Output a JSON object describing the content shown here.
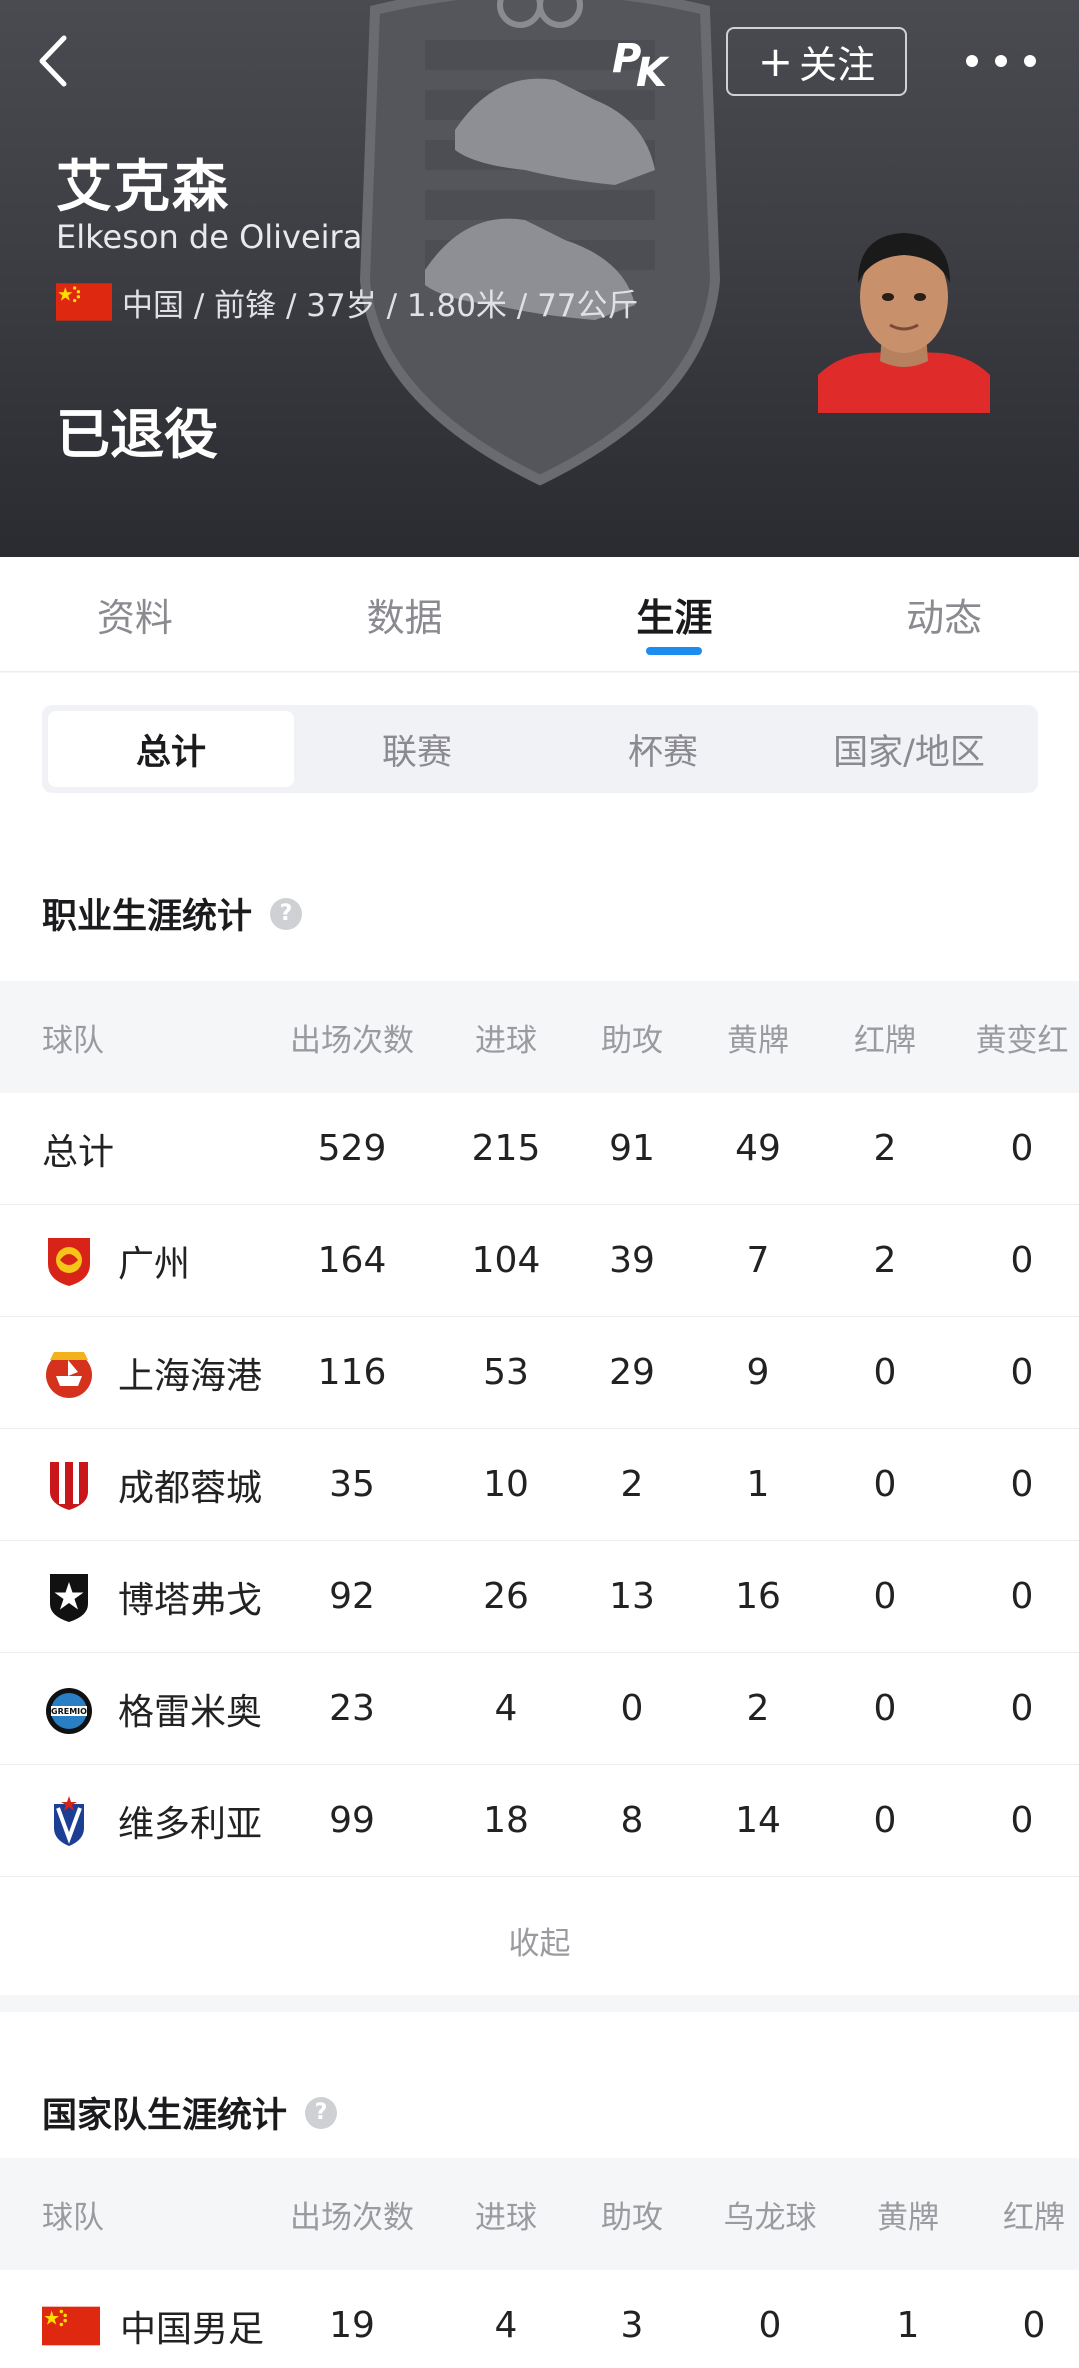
{
  "header": {
    "follow_label": "关注",
    "player_name": "艾克森",
    "player_name_en": "Elkeson de Oliveira",
    "info": "中国 / 前锋 / 37岁 / 1.80米 / 77公斤",
    "status": "已退役"
  },
  "tabs": [
    "资料",
    "数据",
    "生涯",
    "动态"
  ],
  "active_tab": "生涯",
  "segments": [
    "总计",
    "联赛",
    "杯赛",
    "国家/地区"
  ],
  "active_segment": "总计",
  "career": {
    "title": "职业生涯统计",
    "headers": [
      "球队",
      "出场次数",
      "进球",
      "助攻",
      "黄牌",
      "红牌",
      "黄变红"
    ],
    "rows": [
      {
        "team": "总计",
        "logo": "",
        "values": [
          "529",
          "215",
          "91",
          "49",
          "2",
          "0"
        ]
      },
      {
        "team": "广州",
        "logo": "guangzhou-logo",
        "values": [
          "164",
          "104",
          "39",
          "7",
          "2",
          "0"
        ]
      },
      {
        "team": "上海海港",
        "logo": "shanghai-port-logo",
        "values": [
          "116",
          "53",
          "29",
          "9",
          "0",
          "0"
        ]
      },
      {
        "team": "成都蓉城",
        "logo": "chengdu-logo",
        "values": [
          "35",
          "10",
          "2",
          "1",
          "0",
          "0"
        ]
      },
      {
        "team": "博塔弗戈",
        "logo": "botafogo-logo",
        "values": [
          "92",
          "26",
          "13",
          "16",
          "0",
          "0"
        ]
      },
      {
        "team": "格雷米奥",
        "logo": "gremio-logo",
        "values": [
          "23",
          "4",
          "0",
          "2",
          "0",
          "0"
        ]
      },
      {
        "team": "维多利亚",
        "logo": "vitoria-logo",
        "values": [
          "99",
          "18",
          "8",
          "14",
          "0",
          "0"
        ]
      }
    ],
    "collapse_label": "收起"
  },
  "national": {
    "title": "国家队生涯统计",
    "headers": [
      "球队",
      "出场次数",
      "进球",
      "助攻",
      "乌龙球",
      "黄牌",
      "红牌"
    ],
    "rows": [
      {
        "team": "中国男足",
        "logo": "china-flag",
        "values": [
          "19",
          "4",
          "3",
          "0",
          "1",
          "0"
        ]
      }
    ]
  },
  "colors": {
    "accent": "#1c8cf0",
    "header_bg": "#3d3e44",
    "china_red": "#de2910",
    "china_yellow": "#ffde00"
  }
}
